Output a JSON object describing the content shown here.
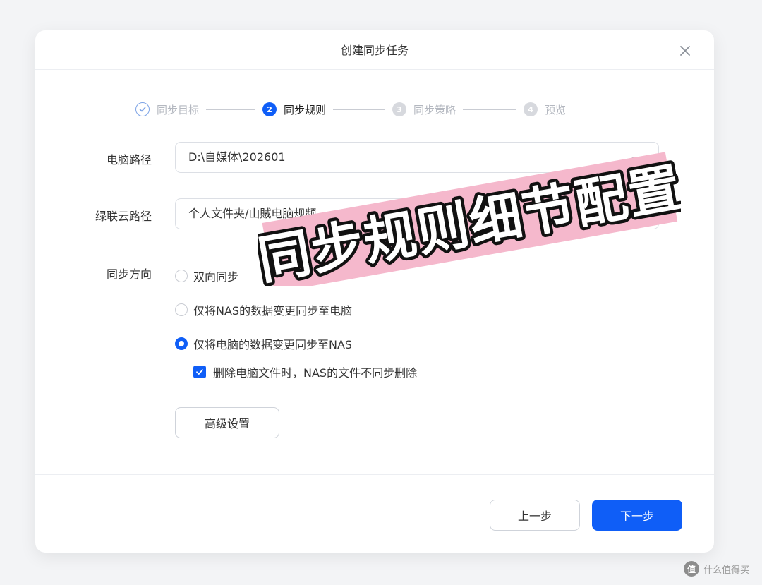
{
  "dialog": {
    "title": "创建同步任务"
  },
  "steps": [
    {
      "number": "",
      "label": "同步目标",
      "state": "done"
    },
    {
      "number": "2",
      "label": "同步规则",
      "state": "active"
    },
    {
      "number": "3",
      "label": "同步策略",
      "state": "pending"
    },
    {
      "number": "4",
      "label": "预览",
      "state": "pending"
    }
  ],
  "form": {
    "pc_path_label": "电脑路径",
    "pc_path_value": "D:\\自媒体\\202601",
    "cloud_path_label": "绿联云路径",
    "cloud_path_value": "个人文件夹/山賊电脑规频",
    "direction_label": "同步方向",
    "direction_options": [
      {
        "label": "双向同步",
        "selected": false
      },
      {
        "label": "仅将NAS的数据变更同步至电脑",
        "selected": false
      },
      {
        "label": "仅将电脑的数据变更同步至NAS",
        "selected": true
      }
    ],
    "no_delete_checkbox_label": "删除电脑文件时，NAS的文件不同步删除",
    "no_delete_checked": true,
    "advanced_button": "高级设置"
  },
  "footer": {
    "prev_button": "上一步",
    "next_button": "下一步"
  },
  "overlay": {
    "banner_text": "同步规则细节配置"
  },
  "watermark": {
    "logo": "值",
    "text": "什么值得买"
  },
  "colors": {
    "primary": "#0f5ef7",
    "banner_bg": "#f5b8cc"
  }
}
